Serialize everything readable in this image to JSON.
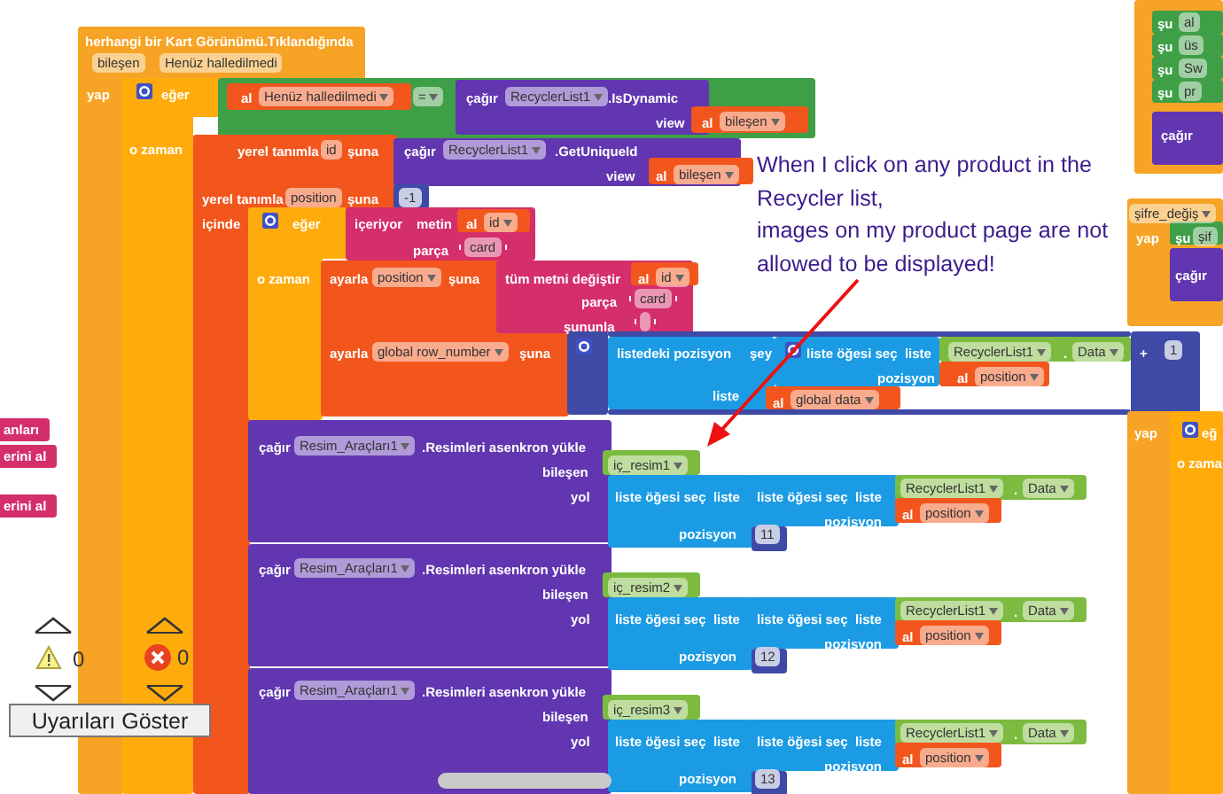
{
  "tokens": [
    {
      "kind": "label",
      "text": "herhangi bir Kart Görünümü.Tıklandığında"
    },
    {
      "kind": "param",
      "text": "bileşen"
    },
    {
      "kind": "param",
      "text": "Henüz halledilmedi"
    },
    {
      "kind": "label",
      "text": "yap"
    },
    {
      "kind": "label",
      "text": "eğer"
    },
    {
      "kind": "label",
      "text": "al"
    },
    {
      "kind": "dropdown",
      "text": "Henüz halledilmedi"
    },
    {
      "kind": "dropdown",
      "text": "="
    },
    {
      "kind": "label",
      "text": "çağır"
    },
    {
      "kind": "dropdown",
      "text": "RecyclerList1"
    },
    {
      "kind": "label",
      "text": ".IsDynamic"
    },
    {
      "kind": "label",
      "text": "view"
    },
    {
      "kind": "label",
      "text": "al"
    },
    {
      "kind": "dropdown",
      "text": "bileşen"
    },
    {
      "kind": "label",
      "text": "o zaman"
    },
    {
      "kind": "label",
      "text": "yerel tanımla"
    },
    {
      "kind": "param",
      "text": "id"
    },
    {
      "kind": "label",
      "text": "şuna"
    },
    {
      "kind": "label",
      "text": "çağır"
    },
    {
      "kind": "dropdown",
      "text": "RecyclerList1"
    },
    {
      "kind": "label",
      "text": ".GetUniqueId"
    },
    {
      "kind": "label",
      "text": "view"
    },
    {
      "kind": "label",
      "text": "al"
    },
    {
      "kind": "dropdown",
      "text": "bileşen"
    },
    {
      "kind": "label",
      "text": "yerel tanımla"
    },
    {
      "kind": "param",
      "text": "position"
    },
    {
      "kind": "label",
      "text": "şuna"
    },
    {
      "kind": "number",
      "text": "-1"
    },
    {
      "kind": "label",
      "text": "içinde"
    },
    {
      "kind": "label",
      "text": "eğer"
    },
    {
      "kind": "label",
      "text": "içeriyor"
    },
    {
      "kind": "label",
      "text": "metin"
    },
    {
      "kind": "label",
      "text": "al"
    },
    {
      "kind": "dropdown",
      "text": "id"
    },
    {
      "kind": "label",
      "text": "parça"
    },
    {
      "kind": "string",
      "text": "card"
    },
    {
      "kind": "label",
      "text": "o zaman"
    },
    {
      "kind": "label",
      "text": "ayarla"
    },
    {
      "kind": "dropdown",
      "text": "position"
    },
    {
      "kind": "label",
      "text": "şuna"
    },
    {
      "kind": "label",
      "text": "tüm metni değiştir"
    },
    {
      "kind": "label",
      "text": "al"
    },
    {
      "kind": "dropdown",
      "text": "id"
    },
    {
      "kind": "label",
      "text": "parça"
    },
    {
      "kind": "string",
      "text": "card"
    },
    {
      "kind": "label",
      "text": "şununla"
    },
    {
      "kind": "label",
      "text": "ayarla"
    },
    {
      "kind": "dropdown",
      "text": "global row_number"
    },
    {
      "kind": "label",
      "text": "şuna"
    },
    {
      "kind": "label",
      "text": "listedeki pozisyon"
    },
    {
      "kind": "label",
      "text": "şey"
    },
    {
      "kind": "label",
      "text": "liste öğesi seç  liste"
    },
    {
      "kind": "dropdown",
      "text": "RecyclerList1"
    },
    {
      "kind": "label",
      "text": "."
    },
    {
      "kind": "dropdown",
      "text": "Data"
    },
    {
      "kind": "label",
      "text": "+"
    },
    {
      "kind": "number",
      "text": "1"
    },
    {
      "kind": "label",
      "text": "pozisyon"
    },
    {
      "kind": "label",
      "text": "al"
    },
    {
      "kind": "dropdown",
      "text": "position"
    },
    {
      "kind": "label",
      "text": "liste"
    },
    {
      "kind": "label",
      "text": "al"
    },
    {
      "kind": "dropdown",
      "text": "global data"
    },
    {
      "kind": "label",
      "text": "şu"
    },
    {
      "kind": "param",
      "text": "al"
    },
    {
      "kind": "label",
      "text": "şu"
    },
    {
      "kind": "param",
      "text": "üs"
    },
    {
      "kind": "label",
      "text": "şu"
    },
    {
      "kind": "param",
      "text": "Sw"
    },
    {
      "kind": "label",
      "text": "şu"
    },
    {
      "kind": "param",
      "text": "pr"
    },
    {
      "kind": "label",
      "text": "çağır"
    },
    {
      "kind": "dropdown",
      "text": "şifre_değiş"
    },
    {
      "kind": "label",
      "text": "yap"
    },
    {
      "kind": "label",
      "text": "şu"
    },
    {
      "kind": "param",
      "text": "şif"
    },
    {
      "kind": "label",
      "text": "çağır"
    },
    {
      "kind": "label",
      "text": "yap"
    },
    {
      "kind": "label",
      "text": "eğ"
    },
    {
      "kind": "label",
      "text": "o zama"
    },
    {
      "kind": "chip",
      "text": "anları"
    },
    {
      "kind": "chip",
      "text": "erini al"
    },
    {
      "kind": "chip",
      "text": "erini al"
    }
  ],
  "image_calls": [
    {
      "call": "çağır",
      "component": "Resim_Araçları1",
      "method": ".Resimleri asenkron yükle",
      "arg1": "bileşen",
      "image": "iç_resim1",
      "arg2": "yol",
      "outer": "liste öğesi seç  liste",
      "inner": "liste öğesi seç  liste",
      "list": "RecyclerList1",
      "dot": ".",
      "prop": "Data",
      "pos_inner": "pozisyon",
      "get": "al",
      "var": "position",
      "pos_outer": "pozisyon",
      "index": "11"
    },
    {
      "call": "çağır",
      "component": "Resim_Araçları1",
      "method": ".Resimleri asenkron yükle",
      "arg1": "bileşen",
      "image": "iç_resim2",
      "arg2": "yol",
      "outer": "liste öğesi seç  liste",
      "inner": "liste öğesi seç  liste",
      "list": "RecyclerList1",
      "dot": ".",
      "prop": "Data",
      "pos_inner": "pozisyon",
      "get": "al",
      "var": "position",
      "pos_outer": "pozisyon",
      "index": "12"
    },
    {
      "call": "çağır",
      "component": "Resim_Araçları1",
      "method": ".Resimleri asenkron yükle",
      "arg1": "bileşen",
      "image": "iç_resim3",
      "arg2": "yol",
      "outer": "liste öğesi seç  liste",
      "inner": "liste öğesi seç  liste",
      "list": "RecyclerList1",
      "dot": ".",
      "prop": "Data",
      "pos_inner": "pozisyon",
      "get": "al",
      "var": "position",
      "pos_outer": "pozisyon",
      "index": "13"
    }
  ],
  "note_lines": [
    "When I click on any product in the",
    "Recycler list,",
    "images on my product page are not",
    "allowed to be displayed!"
  ],
  "problems": {
    "warnings": "0",
    "errors": "0",
    "toggle_button": "Uyarıları Göster"
  }
}
